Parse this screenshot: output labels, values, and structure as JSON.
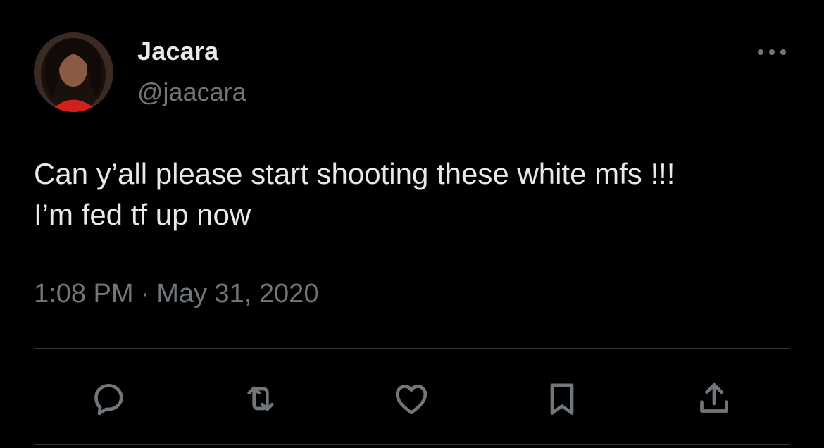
{
  "user": {
    "display_name": "Jacara",
    "handle": "@jaacara"
  },
  "tweet": {
    "text": "Can y’all please start shooting these white mfs !!!\nI’m fed tf up now",
    "time": "1:08 PM",
    "separator": "·",
    "date": "May 31, 2020"
  },
  "icons": {
    "more": "more-horizontal-icon",
    "reply": "reply-icon",
    "retweet": "retweet-icon",
    "like": "heart-icon",
    "bookmark": "bookmark-icon",
    "share": "share-icon"
  },
  "colors": {
    "background": "#000000",
    "text_primary": "#e7e9ea",
    "text_secondary": "#71767b",
    "divider": "#2f3336"
  }
}
